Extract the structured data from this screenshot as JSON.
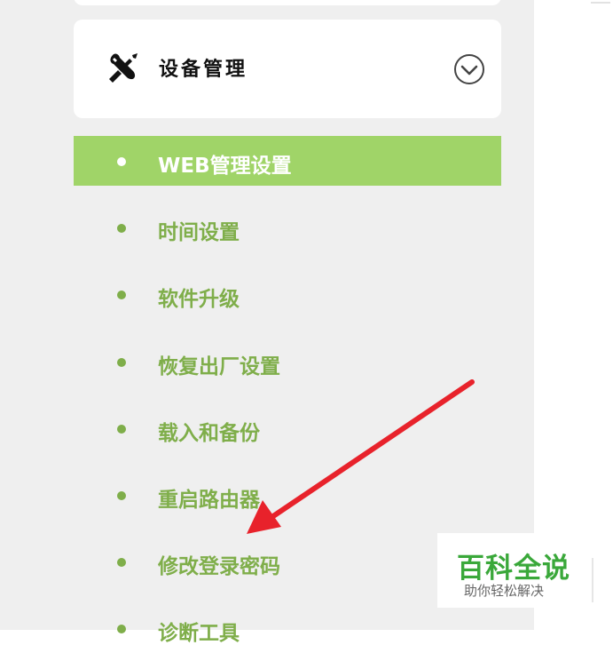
{
  "section": {
    "title": "设备管理",
    "icon": "tools-icon",
    "toggle_icon": "chevron-down-circle-icon"
  },
  "menu": {
    "items": [
      {
        "label": "WEB管理设置",
        "active": true
      },
      {
        "label": "时间设置",
        "active": false
      },
      {
        "label": "软件升级",
        "active": false
      },
      {
        "label": "恢复出厂设置",
        "active": false
      },
      {
        "label": "载入和备份",
        "active": false
      },
      {
        "label": "重启路由器",
        "active": false
      },
      {
        "label": "修改登录密码",
        "active": false
      },
      {
        "label": "诊断工具",
        "active": false
      }
    ]
  },
  "watermark": {
    "title": "百科全说",
    "subtitle": "助你轻松解决"
  },
  "colors": {
    "accent_green": "#a0d468",
    "item_green": "#7fae4a",
    "sidebar_bg": "#efefef",
    "arrow_red": "#e8222b",
    "watermark_green": "#3aa83a"
  }
}
